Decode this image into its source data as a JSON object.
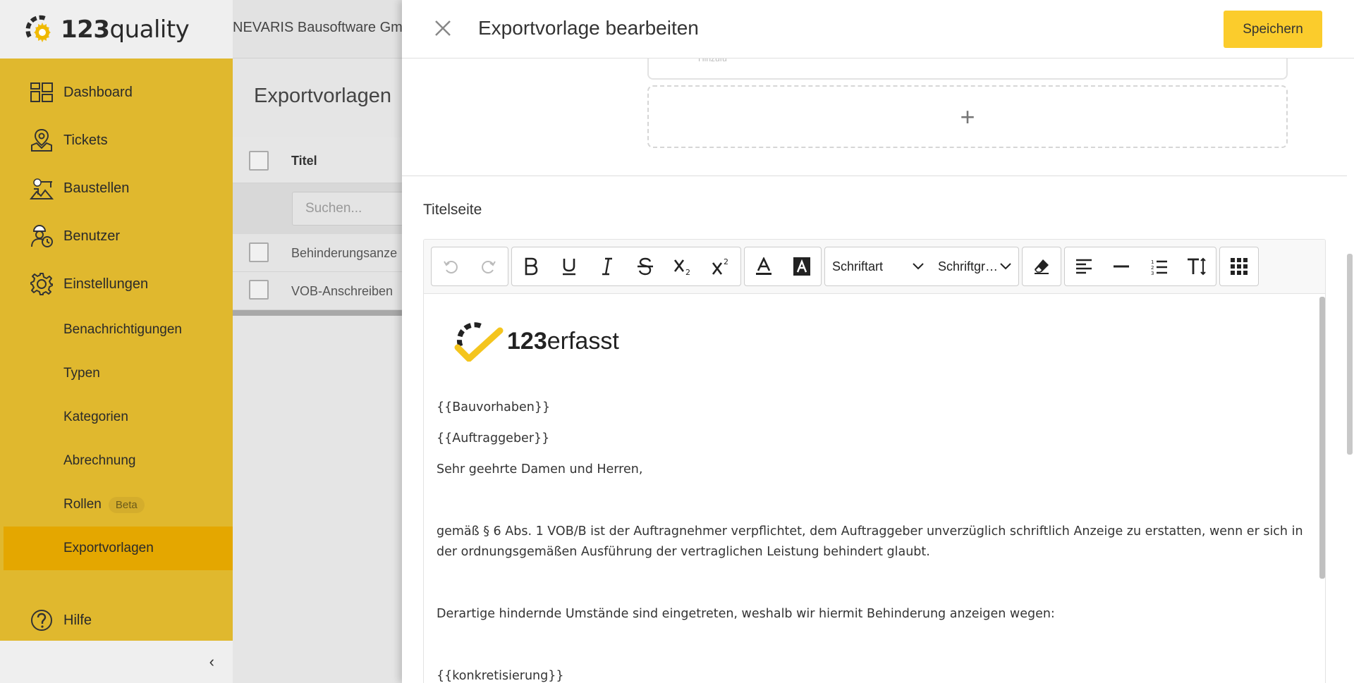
{
  "app": {
    "brand_prefix": "123",
    "brand_suffix": "quality",
    "company": "NEVARIS Bausoftware Gm"
  },
  "sidebar": {
    "items": [
      {
        "label": "Dashboard",
        "icon": "dashboard-icon"
      },
      {
        "label": "Tickets",
        "icon": "map-pin-icon"
      },
      {
        "label": "Baustellen",
        "icon": "construction-site-icon"
      },
      {
        "label": "Benutzer",
        "icon": "worker-icon"
      },
      {
        "label": "Einstellungen",
        "icon": "gear-icon"
      }
    ],
    "sub_items": [
      "Benachrichtigungen",
      "Typen",
      "Kategorien",
      "Abrechnung",
      "Rollen",
      "Exportvorlagen"
    ],
    "beta_badge": "Beta",
    "help": "Hilfe",
    "collapse": "‹"
  },
  "main": {
    "title": "Exportvorlagen",
    "column_title": "Titel",
    "search_placeholder": "Suchen...",
    "rows": [
      "Behinderungsanze",
      "VOB-Anschreiben"
    ]
  },
  "modal": {
    "title": "Exportvorlage bearbeiten",
    "save_label": "Speichern",
    "close": "✕",
    "prev_card_label": "Hinzufü",
    "add_symbol": "+",
    "section_label": "Titelseite",
    "toolbar": {
      "font_family": "Schriftart",
      "font_size": "Schriftgr…"
    },
    "logo_prefix": "123",
    "logo_suffix": "erfasst",
    "paragraphs": [
      "{{Bauvorhaben}}",
      "{{Auftraggeber}}",
      "Sehr geehrte Damen und Herren,",
      "gemäß § 6 Abs. 1 VOB/B ist der Auftragnehmer verpflichtet, dem Auftraggeber unverzüglich schriftlich Anzeige zu erstatten, wenn er sich in der ordnungsgemäßen Ausführung der vertraglichen Leistung behindert glaubt.",
      "Derartige hindernde Umstände sind eingetreten, weshalb wir hiermit Behinderung anzeigen wegen:",
      "{{konkretisierung}}"
    ]
  },
  "colors": {
    "sidebar": "#e0b82e",
    "active": "#e4a700",
    "accent_button": "#fbcc2c"
  }
}
